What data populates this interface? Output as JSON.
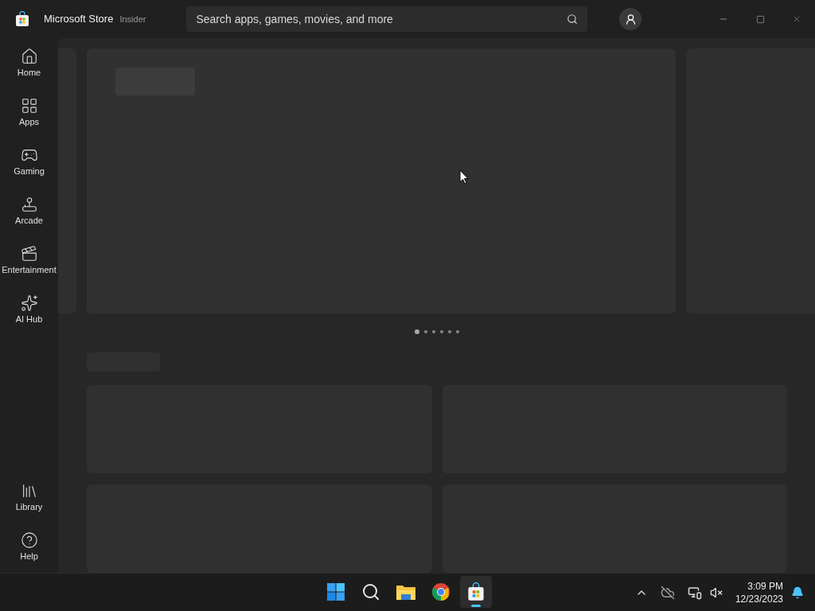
{
  "window": {
    "title": "Microsoft Store",
    "badge": "Insider"
  },
  "search": {
    "placeholder": "Search apps, games, movies, and more"
  },
  "sidebar": {
    "items": [
      {
        "kind": "home",
        "label": "Home"
      },
      {
        "kind": "apps",
        "label": "Apps"
      },
      {
        "kind": "gaming",
        "label": "Gaming"
      },
      {
        "kind": "arcade",
        "label": "Arcade"
      },
      {
        "kind": "entertainment",
        "label": "Entertainment"
      },
      {
        "kind": "ai",
        "label": "AI Hub"
      }
    ],
    "bottom_items": [
      {
        "kind": "library",
        "label": "Library"
      },
      {
        "kind": "help",
        "label": "Help"
      }
    ]
  },
  "carousel": {
    "dots": [
      {
        "selected": true
      },
      {
        "selected": false
      },
      {
        "selected": false
      },
      {
        "selected": false
      },
      {
        "selected": false
      },
      {
        "selected": false
      }
    ]
  },
  "taskbar": {
    "apps": [
      {
        "kind": "start",
        "selected": false
      },
      {
        "kind": "search",
        "selected": false
      },
      {
        "kind": "files",
        "selected": false
      },
      {
        "kind": "chrome",
        "selected": false
      },
      {
        "kind": "store",
        "selected": true
      }
    ],
    "time": "3:09 PM",
    "date": "12/23/2023"
  }
}
